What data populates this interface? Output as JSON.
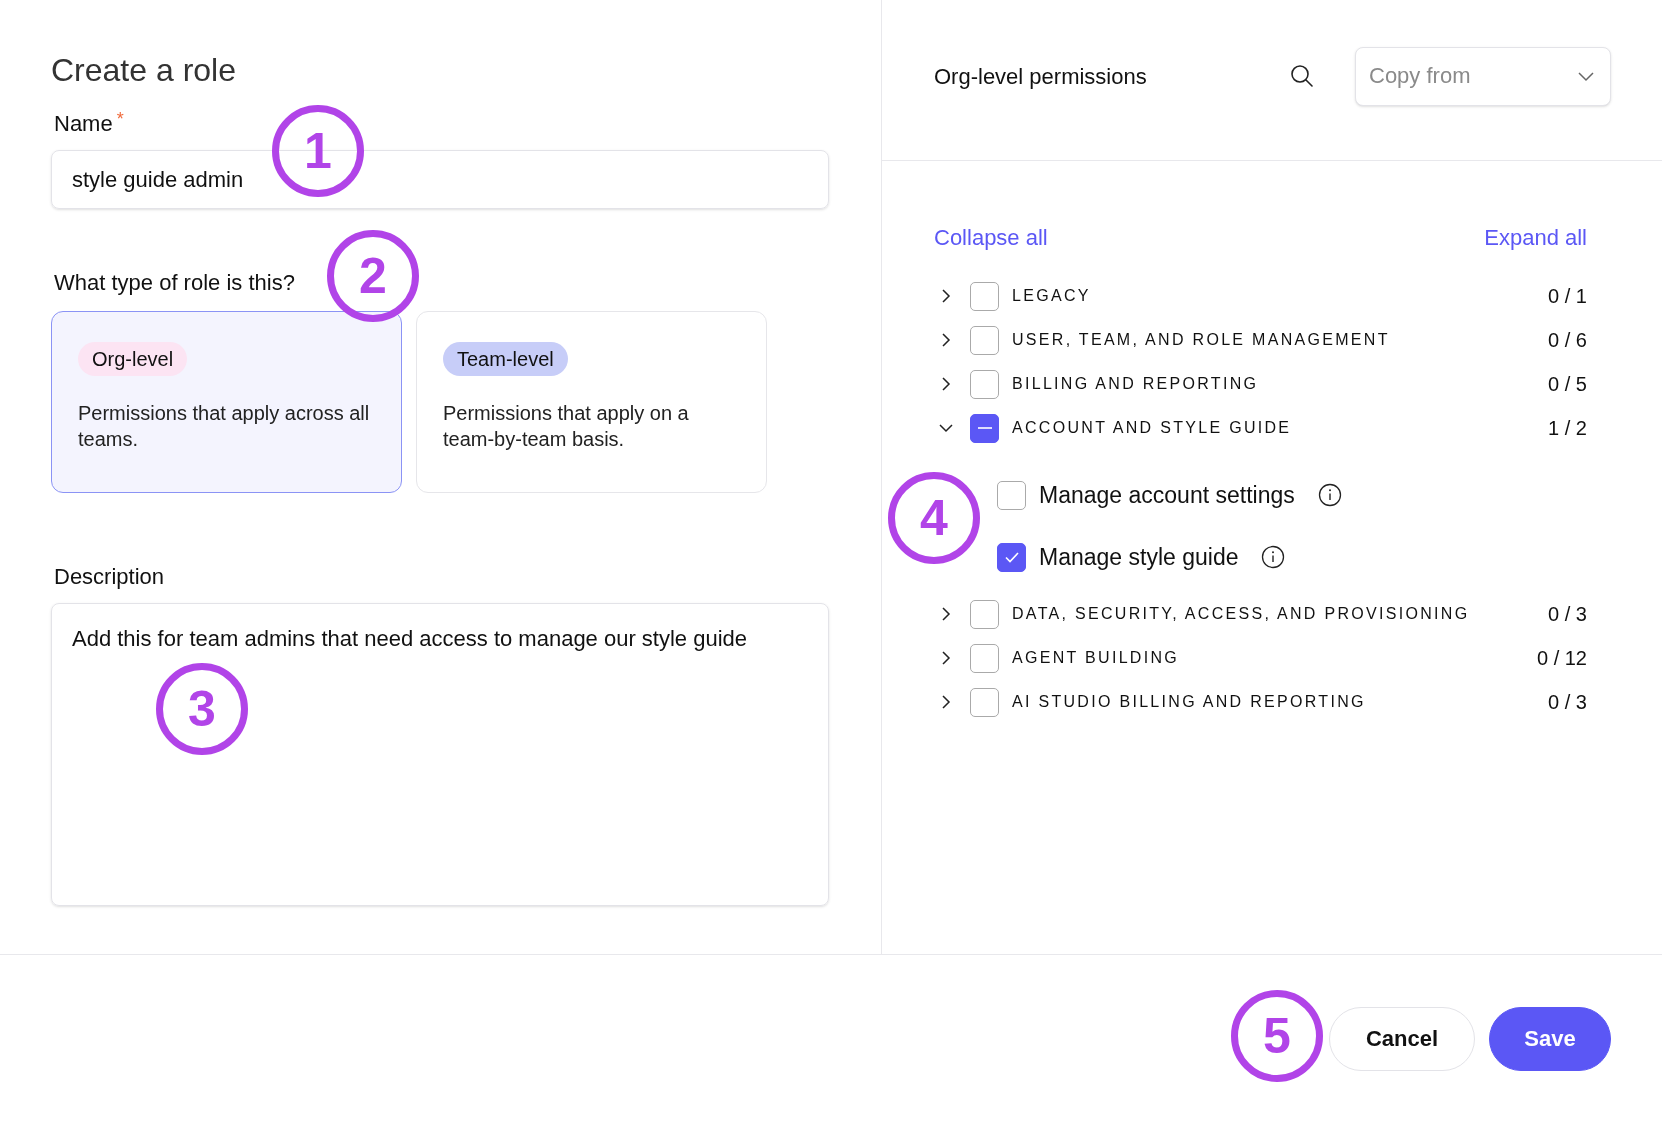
{
  "form": {
    "title": "Create a role",
    "name_field": {
      "label": "Name",
      "required_mark": "*",
      "value": "style guide admin"
    },
    "role_type": {
      "label": "What type of role is this?",
      "options": [
        {
          "tag": "Org-level",
          "color": "#fce4f3",
          "description": "Permissions that apply across all teams.",
          "selected": true
        },
        {
          "tag": "Team-level",
          "color": "#c7cdf8",
          "description": "Permissions that apply on a team-by-team basis.",
          "selected": false
        }
      ]
    },
    "description_field": {
      "label": "Description",
      "value": "Add this for team admins that need access to manage our style guide"
    }
  },
  "permissions": {
    "title": "Org-level permissions",
    "copy_from": {
      "placeholder": "Copy from"
    },
    "collapse_all": "Collapse all",
    "expand_all": "Expand all",
    "groups": [
      {
        "label": "LEGACY",
        "count": "0 / 1",
        "indeterminate": false,
        "expanded": false
      },
      {
        "label": "USER, TEAM, AND ROLE MANAGEMENT",
        "count": "0 / 6",
        "indeterminate": false,
        "expanded": false
      },
      {
        "label": "BILLING AND REPORTING",
        "count": "0 / 5",
        "indeterminate": false,
        "expanded": false
      },
      {
        "label": "ACCOUNT AND STYLE GUIDE",
        "count": "1 / 2",
        "indeterminate": true,
        "expanded": true,
        "children": [
          {
            "label": "Manage account settings",
            "checked": false
          },
          {
            "label": "Manage style guide",
            "checked": true
          }
        ]
      },
      {
        "label": "DATA, SECURITY, ACCESS, AND PROVISIONING",
        "count": "0 / 3",
        "indeterminate": false,
        "expanded": false
      },
      {
        "label": "AGENT BUILDING",
        "count": "0 / 12",
        "indeterminate": false,
        "expanded": false
      },
      {
        "label": "AI STUDIO BILLING AND REPORTING",
        "count": "0 / 3",
        "indeterminate": false,
        "expanded": false
      }
    ]
  },
  "footer": {
    "buttons": [
      {
        "label": "Cancel",
        "kind": "secondary"
      },
      {
        "label": "Save",
        "kind": "primary"
      }
    ]
  },
  "callouts": [
    "1",
    "2",
    "3",
    "4",
    "5"
  ]
}
